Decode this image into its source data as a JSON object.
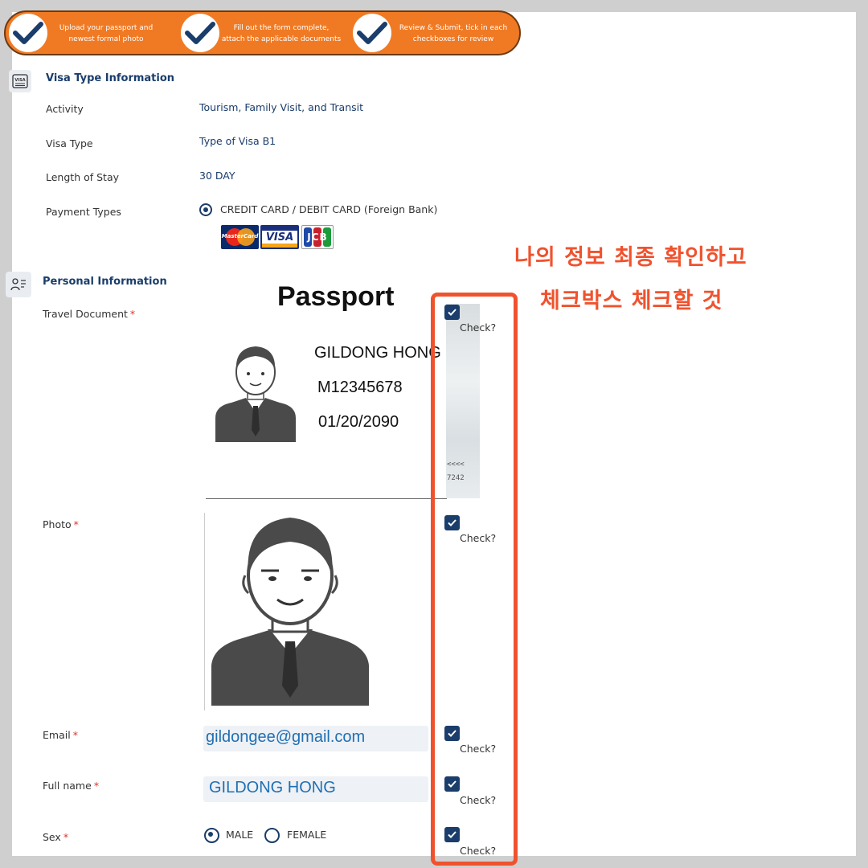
{
  "steps": [
    {
      "text": "Upload your passport and newest formal photo"
    },
    {
      "text": "Fill out the form complete, attach the applicable documents"
    },
    {
      "text": "Review & Submit, tick in each checkboxes for review"
    }
  ],
  "visa_section": {
    "title": "Visa Type Information",
    "icon_text": "VISA",
    "rows": [
      {
        "label": "Activity",
        "value": "Tourism, Family Visit, and Transit"
      },
      {
        "label": "Visa Type",
        "value": "Type of Visa B1"
      },
      {
        "label": "Length of Stay",
        "value": "30 DAY"
      },
      {
        "label": "Payment Types",
        "value": "CREDIT CARD / DEBIT CARD (Foreign Bank)"
      }
    ],
    "cards": [
      "MasterCard",
      "VISA",
      "JCB"
    ]
  },
  "annotation": {
    "line1": "나의 정보 최종 확인하고",
    "line2": "체크박스 체크할 것"
  },
  "personal_section": {
    "title": "Personal Information",
    "labels": {
      "travel_document": "Travel Document",
      "photo": "Photo",
      "email": "Email",
      "full_name": "Full name",
      "sex": "Sex"
    },
    "required_mark": "*",
    "passport": {
      "title": "Passport",
      "name": "GILDONG HONG",
      "number": "M12345678",
      "date": "01/20/2090",
      "strip_line1": "<<<<",
      "strip_line2": "7242"
    },
    "email_value": "gildongee@gmail.com",
    "full_name_value": "GILDONG HONG",
    "sex_options": [
      "MALE",
      "FEMALE"
    ],
    "sex_selected": "MALE",
    "check_label": "Check?"
  },
  "colors": {
    "banner": "#f07a24",
    "navy": "#1a3d6b",
    "annotation": "#f0522e"
  }
}
